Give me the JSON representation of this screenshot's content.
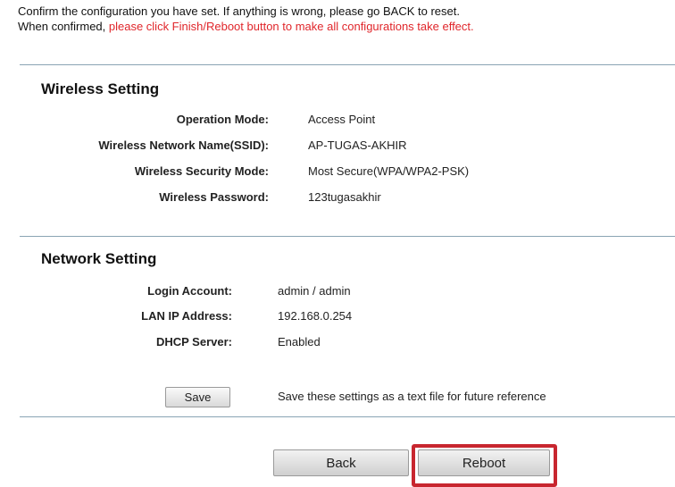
{
  "intro": {
    "line1": "Confirm the configuration you have set. If anything is wrong, please go BACK to reset.",
    "line2_prefix": "When confirmed, ",
    "line2_warning": "please click Finish/Reboot button to make all configurations take effect."
  },
  "wireless": {
    "title": "Wireless Setting",
    "rows": [
      {
        "label": "Operation Mode:",
        "value": "Access Point"
      },
      {
        "label": "Wireless Network Name(SSID):",
        "value": "AP-TUGAS-AKHIR"
      },
      {
        "label": "Wireless Security Mode:",
        "value": "Most Secure(WPA/WPA2-PSK)"
      },
      {
        "label": "Wireless Password:",
        "value": "123tugasakhir"
      }
    ]
  },
  "network": {
    "title": "Network Setting",
    "rows": [
      {
        "label": "Login Account:",
        "value": "admin / admin"
      },
      {
        "label": "LAN IP Address:",
        "value": "192.168.0.254"
      },
      {
        "label": "DHCP Server:",
        "value": "Enabled"
      }
    ]
  },
  "save": {
    "button_label": "Save",
    "note": "Save these settings as a text file for future reference"
  },
  "footer": {
    "back_label": "Back",
    "reboot_label": "Reboot"
  },
  "colors": {
    "warning_text": "#e0262b",
    "highlight_border": "#c8262f",
    "divider": "#8aa4b4"
  }
}
